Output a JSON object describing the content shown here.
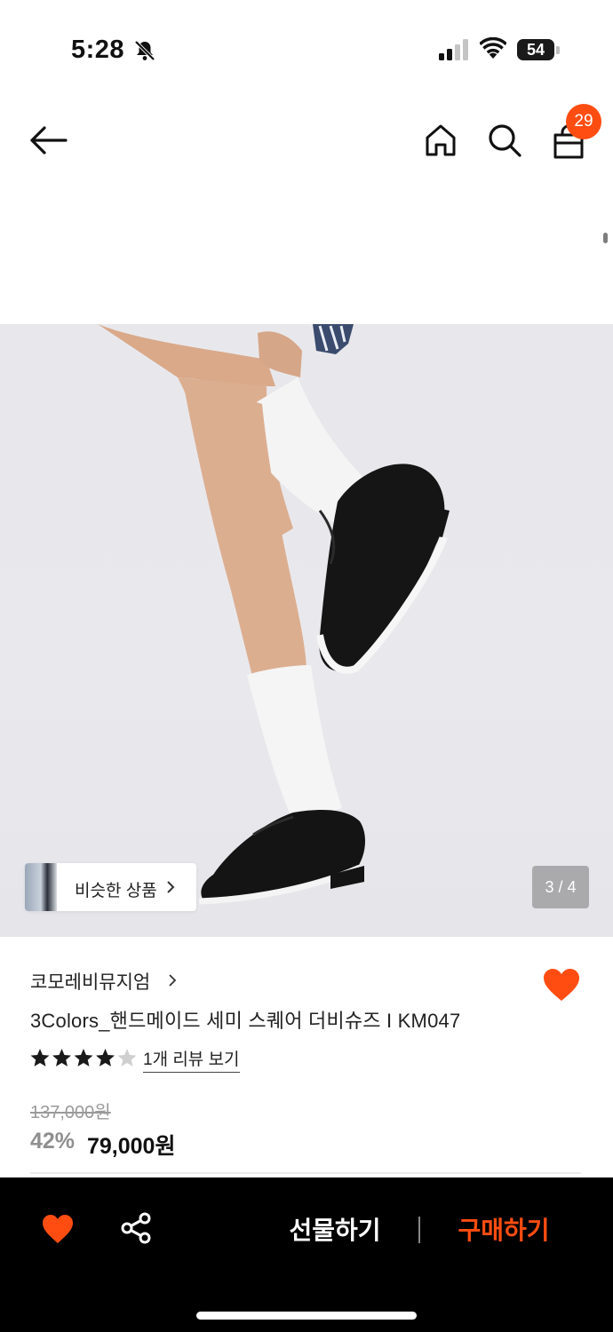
{
  "status_bar": {
    "time": "5:28",
    "battery": "54",
    "icons": [
      "bell-slash-icon",
      "signal-icon",
      "wifi-icon",
      "battery-icon"
    ]
  },
  "nav": {
    "icons": [
      "back-arrow-icon",
      "home-icon",
      "search-icon",
      "shopping-bag-icon"
    ],
    "cart_count": "29"
  },
  "gallery": {
    "similar_label": "비슷한 상품",
    "page_counter": "3 / 4",
    "current_page": 3,
    "total_pages": 4
  },
  "product": {
    "brand": "코모레비뮤지엄",
    "title": "3Colors_핸드메이드 세미 스퀘어 더비슈즈 I KM047",
    "rating": 4,
    "rating_max": 5,
    "review_link": "1개 리뷰 보기",
    "original_price": "137,000원",
    "discount_rate": "42%",
    "sale_price": "79,000원",
    "wishlisted": true
  },
  "bottom_bar": {
    "gift_label": "선물하기",
    "buy_label": "구매하기",
    "icons": [
      "heart-icon",
      "share-icon"
    ]
  },
  "colors": {
    "accent": "#ff4d12",
    "bottom_bar_bg": "#000000",
    "heart": "#ff4d12",
    "star": "#1a1a1a",
    "star_empty": "#cfcfcf"
  }
}
